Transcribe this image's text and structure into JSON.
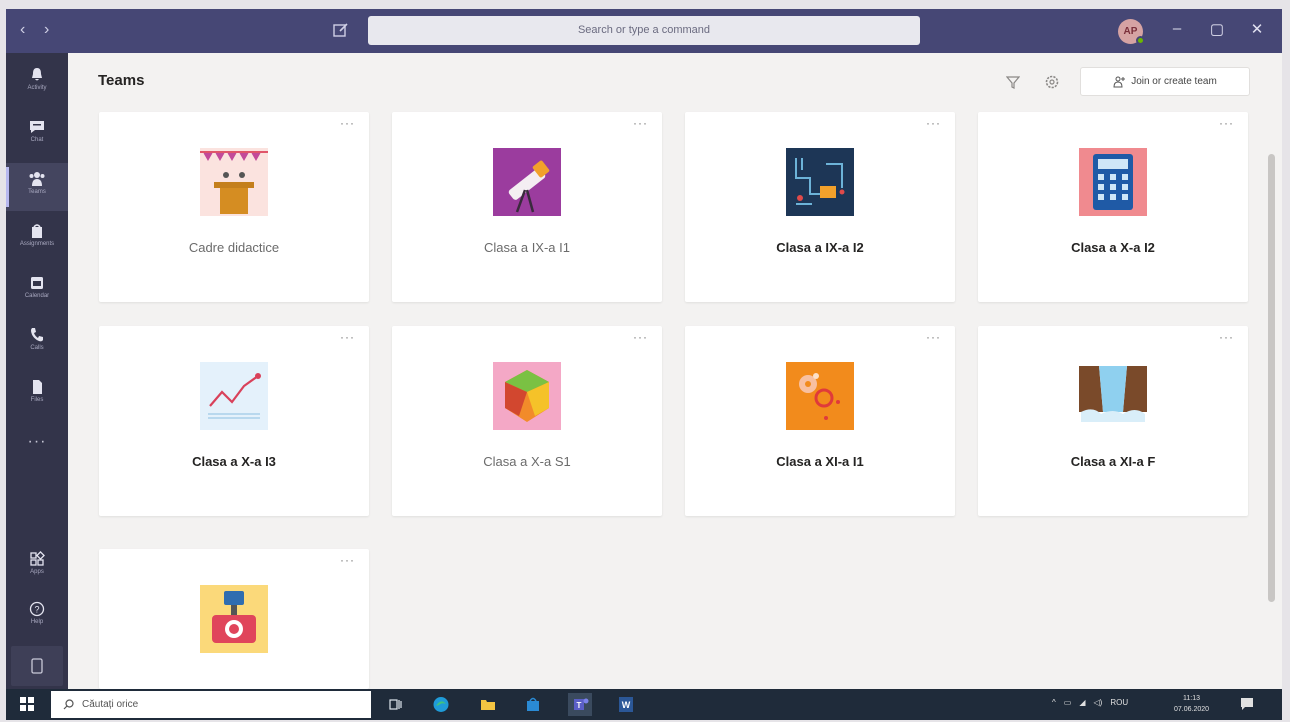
{
  "titlebar": {
    "search_placeholder": "Search or type a command",
    "avatar_initials": "AP"
  },
  "rail": {
    "items": [
      {
        "label": "Activity",
        "icon": "bell-icon"
      },
      {
        "label": "Chat",
        "icon": "chat-icon"
      },
      {
        "label": "Teams",
        "icon": "teams-icon"
      },
      {
        "label": "Assignments",
        "icon": "assignments-icon"
      },
      {
        "label": "Calendar",
        "icon": "calendar-icon"
      },
      {
        "label": "Calls",
        "icon": "phone-icon"
      },
      {
        "label": "Files",
        "icon": "file-icon"
      },
      {
        "label": "Apps",
        "icon": "apps-icon"
      },
      {
        "label": "Help",
        "icon": "help-icon"
      }
    ],
    "more": "···"
  },
  "header": {
    "title": "Teams",
    "join_button": "Join or create team"
  },
  "teams": [
    {
      "name": "Cadre didactice",
      "style": "light",
      "logo": "podium"
    },
    {
      "name": "Clasa a IX-a I1",
      "style": "light",
      "logo": "telescope"
    },
    {
      "name": "Clasa a IX-a I2",
      "style": "bold",
      "logo": "circuit"
    },
    {
      "name": "Clasa a X-a I2",
      "style": "bold",
      "logo": "calculator"
    },
    {
      "name": "Clasa a X-a I3",
      "style": "bold",
      "logo": "chart"
    },
    {
      "name": "Clasa a X-a S1",
      "style": "light",
      "logo": "polyhedron"
    },
    {
      "name": "Clasa a XI-a I1",
      "style": "bold",
      "logo": "gears"
    },
    {
      "name": "Clasa a XI-a F",
      "style": "bold",
      "logo": "waterfall"
    },
    {
      "name": "",
      "style": "bold",
      "logo": "camera"
    }
  ],
  "card_more": "···",
  "taskbar": {
    "search_placeholder": "Căutați orice",
    "language": "ROU",
    "time": "11:13",
    "date": "07.06.2020"
  },
  "colors": {
    "titlebar": "#464775",
    "rail": "#33344a",
    "canvas": "#f3f2f1"
  }
}
